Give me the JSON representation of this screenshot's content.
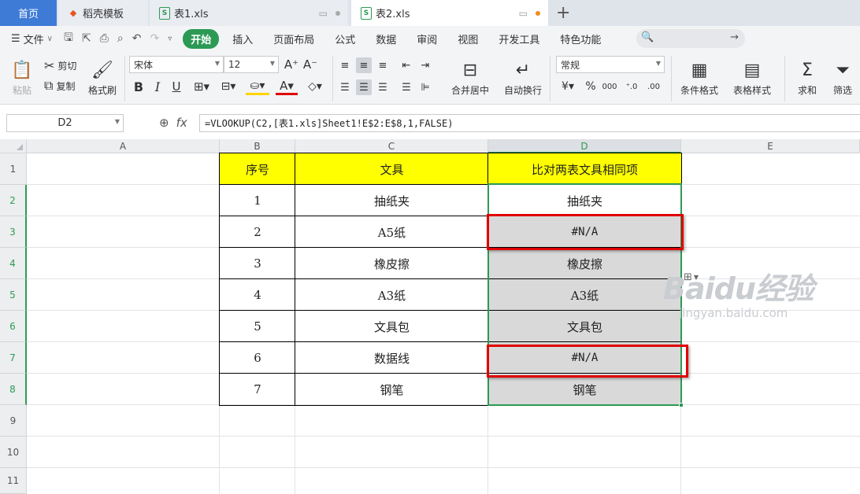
{
  "tabs": {
    "home": "首页",
    "templates": "稻壳模板",
    "file1": "表1.xls",
    "file2": "表2.xls",
    "add": "+"
  },
  "menu": {
    "file": "文件",
    "items": [
      "开始",
      "插入",
      "页面布局",
      "公式",
      "数据",
      "审阅",
      "视图",
      "开发工具",
      "特色功能"
    ]
  },
  "ribbon": {
    "paste": "粘贴",
    "cut": "剪切",
    "copy": "复制",
    "format_painter": "格式刷",
    "font_name": "宋体",
    "font_size": "12",
    "number_format": "常规",
    "merge_center": "合并居中",
    "wrap_text": "自动换行",
    "conditional_format": "条件格式",
    "table_style": "表格样式",
    "sum": "求和",
    "filter": "筛选"
  },
  "formula_bar": {
    "cell_ref": "D2",
    "fx": "fx",
    "formula": "=VLOOKUP(C2,[表1.xls]Sheet1!E$2:E$8,1,FALSE)"
  },
  "sheet": {
    "columns": [
      "A",
      "B",
      "C",
      "D",
      "E"
    ],
    "rows": [
      "1",
      "2",
      "3",
      "4",
      "5",
      "6",
      "7",
      "8",
      "9",
      "10",
      "11"
    ],
    "headers": [
      "序号",
      "文具",
      "比对两表文具相同项"
    ],
    "data": [
      [
        "1",
        "抽纸夹",
        "抽纸夹"
      ],
      [
        "2",
        "A5纸",
        "#N/A"
      ],
      [
        "3",
        "橡皮擦",
        "橡皮擦"
      ],
      [
        "4",
        "A3纸",
        "A3纸"
      ],
      [
        "5",
        "文具包",
        "文具包"
      ],
      [
        "6",
        "数据线",
        "#N/A"
      ],
      [
        "7",
        "钢笔",
        "钢笔"
      ]
    ]
  },
  "colors": {
    "accent": "#2c9a55",
    "header_fill": "#ffff00",
    "highlight": "#e00000",
    "home_tab": "#3e7bd6"
  },
  "watermark": {
    "main": "Baidu经验",
    "sub": "jingyan.baidu.com"
  }
}
